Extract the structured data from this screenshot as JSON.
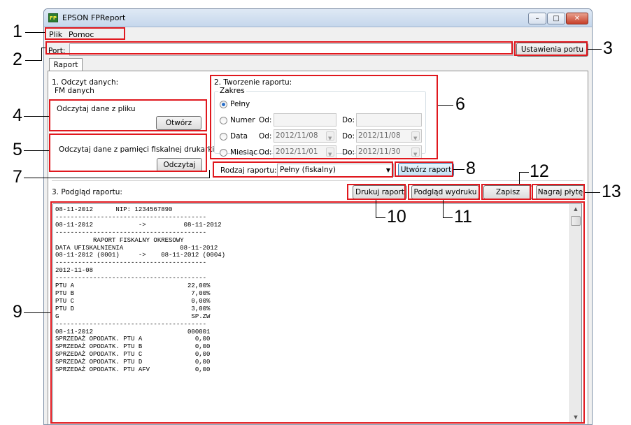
{
  "window": {
    "title": "EPSON FPReport",
    "icon": "FP",
    "controls": [
      "–",
      "□",
      "✕"
    ]
  },
  "menu": {
    "items": [
      "Plik",
      "Pomoc"
    ]
  },
  "port": {
    "label": "Port:",
    "value": "",
    "settings_button": "Ustawienia portu"
  },
  "tabs": [
    "Raport"
  ],
  "section1": {
    "title": "1. Odczyt danych:",
    "group_title": "FM danych",
    "file": {
      "label": "Odczytaj dane z pliku",
      "button": "Otwórz"
    },
    "memory": {
      "label": "Odczytaj dane z pamięci fiskalnej drukarki",
      "button": "Odczytaj"
    }
  },
  "section2": {
    "title": "2. Tworzenie raportu:",
    "group_title": "Zakres",
    "options": [
      {
        "label": "Pełny",
        "checked": true
      },
      {
        "label": "Numer",
        "from_label": "Od:",
        "from": "",
        "to_label": "Do:",
        "to": ""
      },
      {
        "label": "Data",
        "from_label": "Od:",
        "from": "2012/11/08",
        "to_label": "Do:",
        "to": "2012/11/08"
      },
      {
        "label": "Miesiąc",
        "from_label": "Od:",
        "from": "2012/11/01",
        "to_label": "Do:",
        "to": "2012/11/30"
      }
    ],
    "report_type_label": "Rodzaj raportu:",
    "report_type_value": "Pełny (fiskalny)",
    "create_button": "Utwórz raport"
  },
  "section3": {
    "title": "3. Podgląd raportu:",
    "buttons": {
      "print": "Drukuj raport",
      "preview": "Podgląd wydruku",
      "save": "Zapisz",
      "burn": "Nagraj płytę"
    }
  },
  "report_lines": [
    "08-11-2012      NIP: 1234567890",
    "----------------------------------------",
    "08-11-2012            ->          08-11-2012",
    "----------------------------------------",
    "          RAPORT FISKALNY OKRESOWY",
    "DATA UFISKALNIENIA               08-11-2012",
    "08-11-2012 (0001)     ->    08-11-2012 (0004)",
    "----------------------------------------",
    "2012-11-08",
    "----------------------------------------",
    "PTU A                              22,00%",
    "PTU B                               7,00%",
    "PTU C                               0,00%",
    "PTU D                               3,00%",
    "G                                   SP.ZW",
    "----------------------------------------",
    "08-11-2012                         000001",
    "SPRZEDAŻ OPODATK. PTU A              0,00",
    "SPRZEDAŻ OPODATK. PTU B              0,00",
    "SPRZEDAŻ OPODATK. PTU C              0,00",
    "SPRZEDAŻ OPODATK. PTU D              0,00",
    "SPRZEDAŻ OPODATK. PTU AFV            0,00"
  ],
  "annotations": [
    "1",
    "2",
    "3",
    "4",
    "5",
    "6",
    "7",
    "8",
    "9",
    "10",
    "11",
    "12",
    "13"
  ],
  "colors": {
    "annotation": "#e0181e",
    "window_border": "#7c8ea6",
    "radio_checked": "#2a6fc9"
  }
}
